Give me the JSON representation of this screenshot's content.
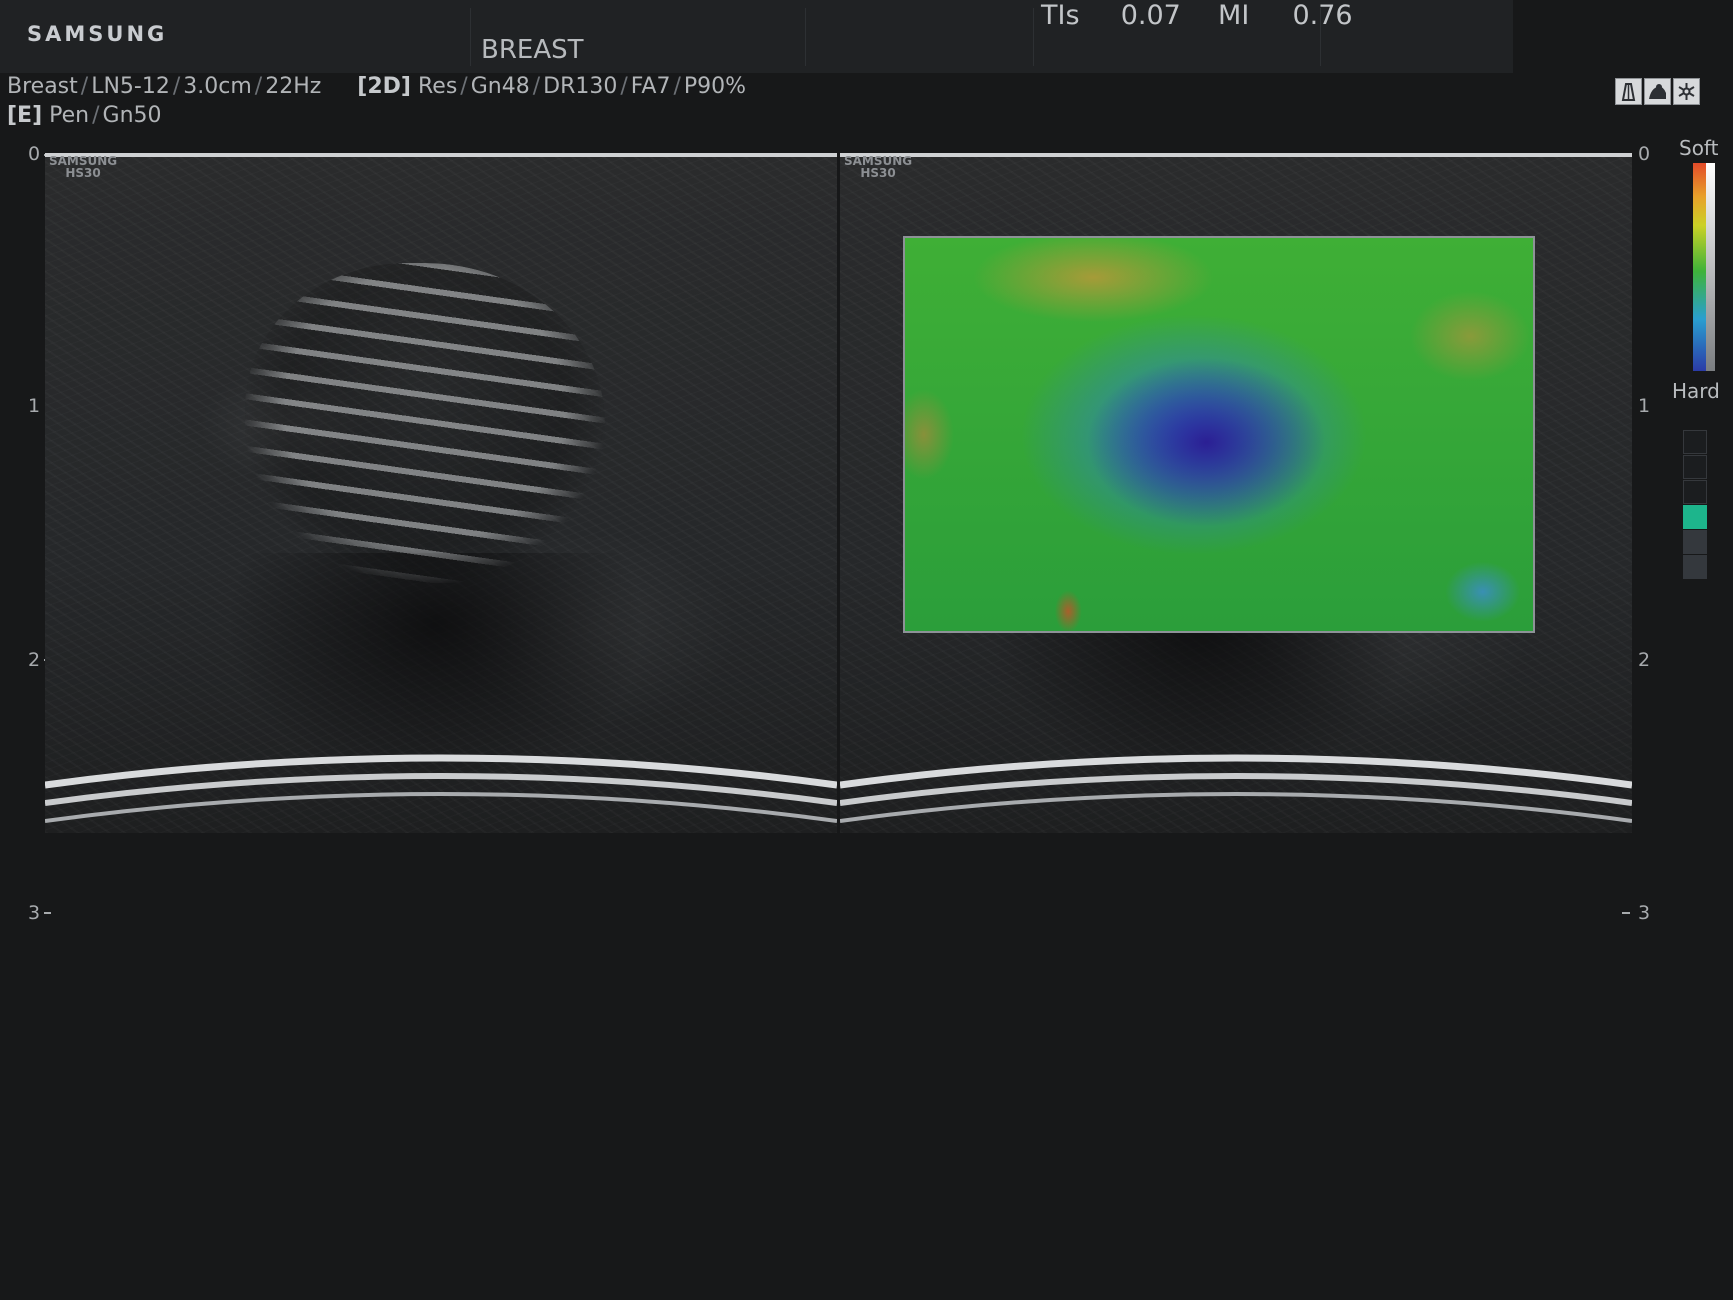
{
  "header": {
    "brand": "SAMSUNG",
    "exam": "BREAST",
    "tis_label": "TIs",
    "tis_value": "0.07",
    "mi_label": "MI",
    "mi_value": "0.76"
  },
  "params": {
    "line1": [
      "Breast",
      "LN5-12",
      "3.0cm",
      "22Hz"
    ],
    "mode2d": "[2D]",
    "line1b": [
      "Res",
      "Gn48",
      "DR130",
      "FA7",
      "P90%"
    ],
    "modeE": "[E]",
    "line2": [
      "Pen",
      "Gn50"
    ]
  },
  "toolbar_icons": [
    "probe-icon",
    "body-mark-icon",
    "snowflake-freeze-icon"
  ],
  "watermark": {
    "line1": "SAMSUNG",
    "line2": "HS30"
  },
  "depth_scale": [
    "0",
    "1",
    "2",
    "3"
  ],
  "legend": {
    "top": "Soft",
    "bottom": "Hard"
  },
  "elasto_quality_level": {
    "filled": 1,
    "total": 6
  },
  "colors": {
    "soft": "#e24b2a",
    "mid": "#3fb33a",
    "hard": "#2b3ba7",
    "quality": "#1db58c"
  }
}
